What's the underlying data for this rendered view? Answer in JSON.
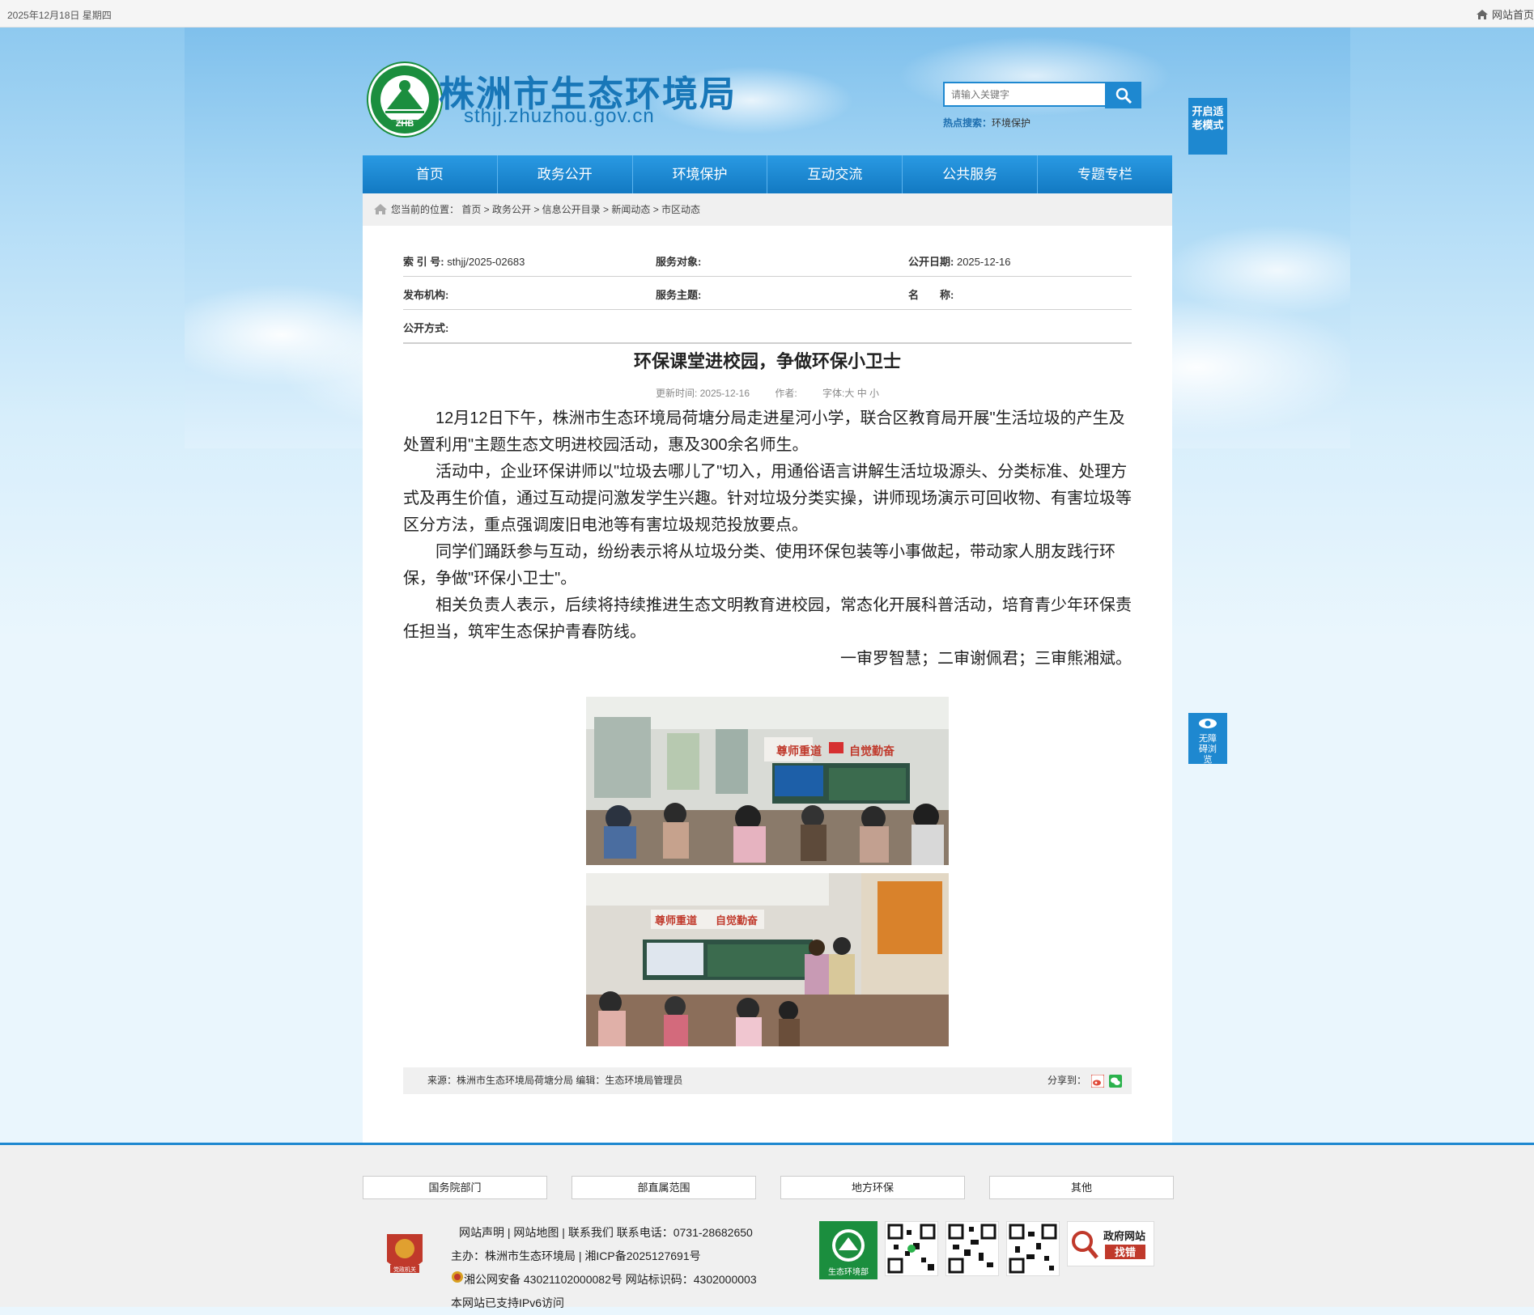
{
  "topbar": {
    "date": "2025年12月18日 星期四",
    "home_link": "网站首页"
  },
  "header": {
    "title": "株洲市生态环境局",
    "domain": "sthjj.zhuzhou.gov.cn",
    "logo_text": "ZHB",
    "search_placeholder": "请输入关键字",
    "hot_label": "热点搜索：",
    "hot_term": "环境保护",
    "elder_mode": "开启适老模式",
    "accessibility": "无障碍浏览"
  },
  "nav": {
    "items": [
      "首页",
      "政务公开",
      "环境保护",
      "互动交流",
      "公共服务",
      "专题专栏"
    ]
  },
  "breadcrumb": "您当前的位置： 首页 > 政务公开 > 信息公开目录 > 新闻动态 > 市区动态",
  "meta": {
    "index_label": "索 引 号:",
    "index_value": "sthjj/2025-02683",
    "target_label": "服务对象:",
    "date_label": "公开日期:",
    "date_value": "2025-12-16",
    "org_label": "发布机构:",
    "topic_label": "服务主题:",
    "name_label": "名　　称:",
    "method_label": "公开方式:"
  },
  "article": {
    "title": "环保课堂进校园，争做环保小卫士",
    "update": "更新时间:  2025-12-16",
    "author": "作者:",
    "font_size": "字体:大 中 小",
    "paragraphs": [
      "12月12日下午，株洲市生态环境局荷塘分局走进星河小学，联合区教育局开展\"生活垃圾的产生及处置利用\"主题生态文明进校园活动，惠及300余名师生。",
      "活动中，企业环保讲师以\"垃圾去哪儿了\"切入，用通俗语言讲解生活垃圾源头、分类标准、处理方式及再生价值，通过互动提问激发学生兴趣。针对垃圾分类实操，讲师现场演示可回收物、有害垃圾等区分方法，重点强调废旧电池等有害垃圾规范投放要点。",
      "同学们踊跃参与互动，纷纷表示将从垃圾分类、使用环保包装等小事做起，带动家人朋友践行环保，争做\"环保小卫士\"。",
      "相关负责人表示，后续将持续推进生态文明教育进校园，常态化开展科普活动，培育青少年环保责任担当，筑牢生态保护青春防线。"
    ],
    "reviewers": "一审罗智慧；二审谢佩君；三审熊湘斌。",
    "slogan_left": "尊师重道",
    "slogan_right": "自觉勤奋",
    "source": "来源：株洲市生态环境局荷塘分局   编辑：生态环境局管理员",
    "share": "分享到："
  },
  "footer": {
    "links": [
      "国务院部门",
      "部直属范围",
      "地方环保",
      "其他"
    ],
    "line1": "网站声明  |  网站地图  |  联系我们    联系电话：0731-28682650",
    "line2": "主办：株洲市生态环境局 | 湘ICP备2025127691号",
    "line3": "湘公网安备 43021102000082号  网站标识码：4302000003",
    "line4": "本网站已支持IPv6访问",
    "zhb_label": "生态环境部",
    "find_line1": "政府网站",
    "find_line2": "找错",
    "badge": "党政机关"
  },
  "colors": {
    "primary": "#1e88d0",
    "title_blue": "#1877b8",
    "logo_green": "#1b8e3e"
  }
}
